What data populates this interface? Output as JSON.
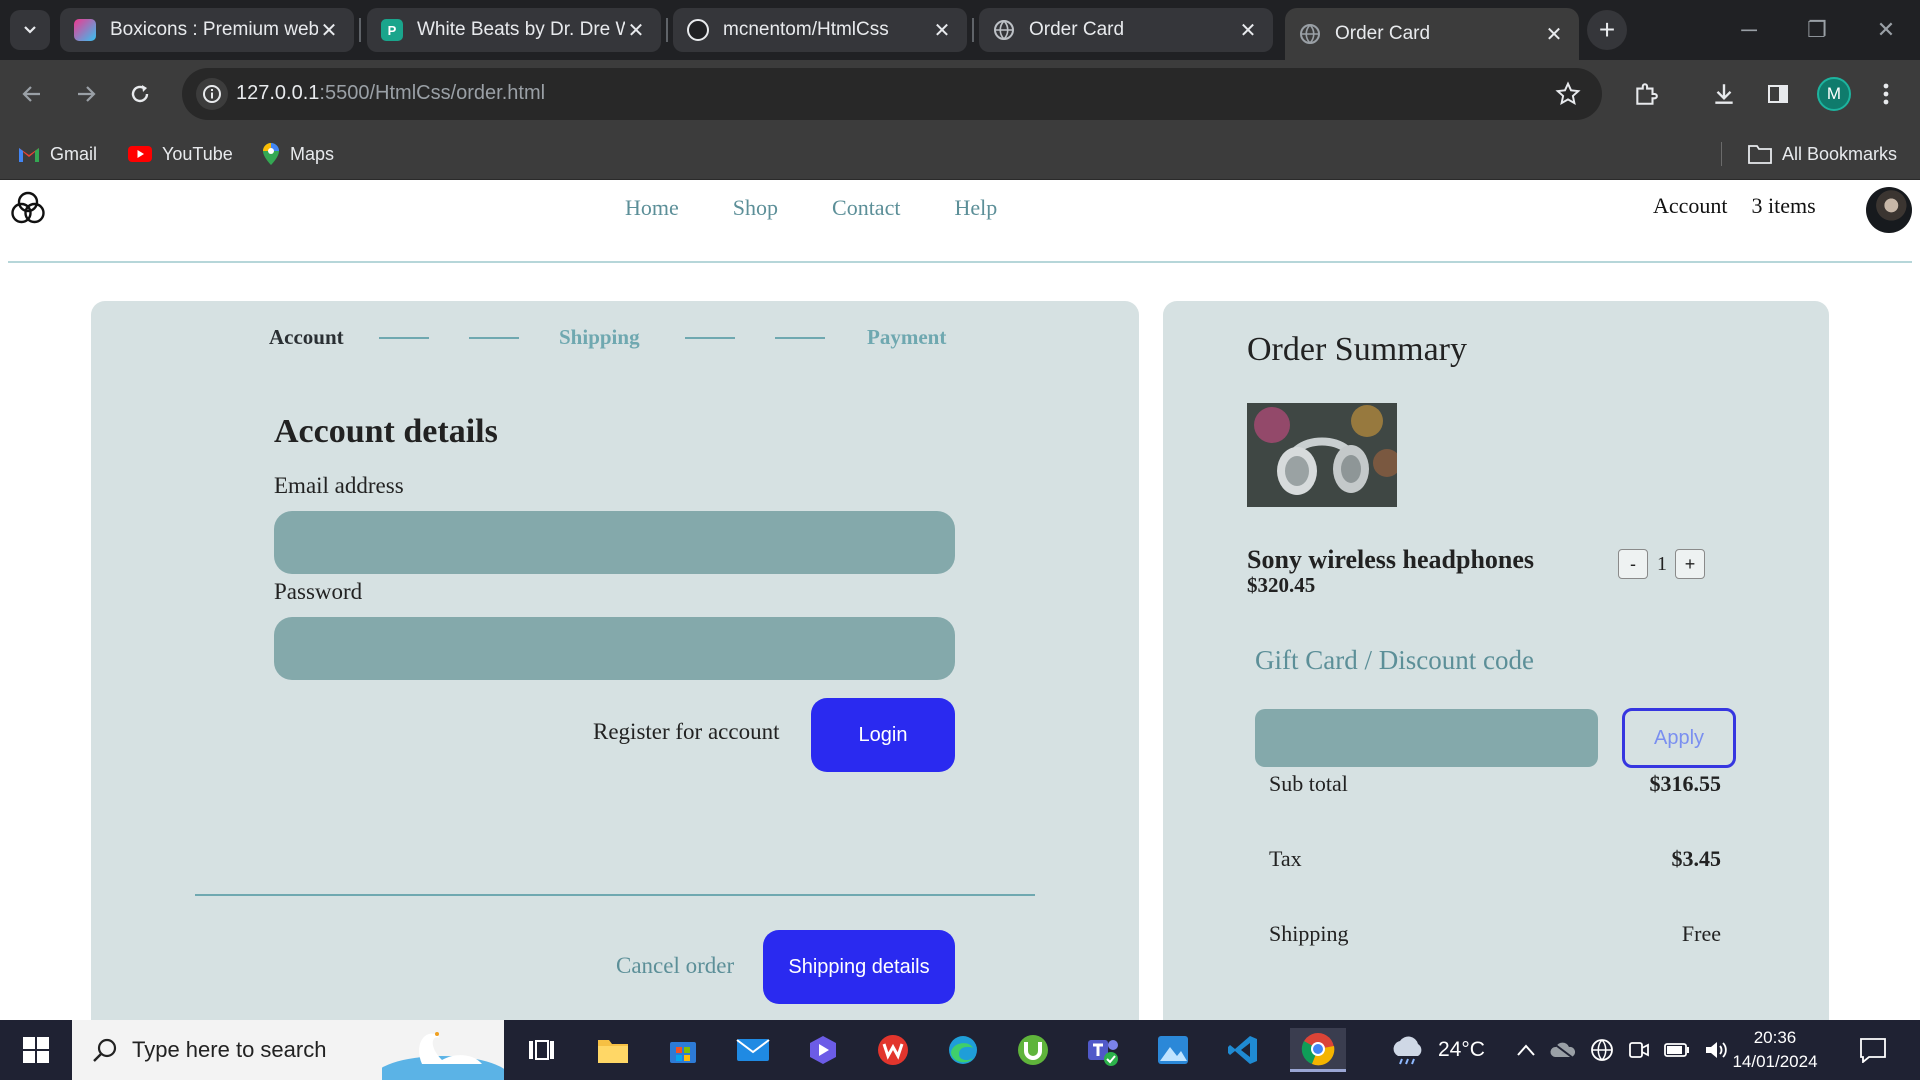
{
  "browser": {
    "tabs": [
      {
        "title": "Boxicons : Premium web",
        "active": false
      },
      {
        "title": "White Beats by Dr. Dre W",
        "active": false
      },
      {
        "title": "mcnentom/HtmlCss",
        "active": false
      },
      {
        "title": "Order Card",
        "active": false
      },
      {
        "title": "Order Card",
        "active": true
      }
    ],
    "url_host": "127.0.0.1",
    "url_path": ":5500/HtmlCss/order.html",
    "profile_initial": "M",
    "bookmarks": [
      {
        "label": "Gmail"
      },
      {
        "label": "YouTube"
      },
      {
        "label": "Maps"
      }
    ],
    "all_bookmarks": "All Bookmarks"
  },
  "site": {
    "nav": [
      "Home",
      "Shop",
      "Contact",
      "Help"
    ],
    "account_link": "Account",
    "cart_count": "3 items"
  },
  "checkout": {
    "steps": [
      {
        "label": "Account",
        "state": "current"
      },
      {
        "label": "Shipping",
        "state": "upcoming"
      },
      {
        "label": "Payment",
        "state": "upcoming"
      }
    ],
    "heading": "Account details",
    "email_label": "Email address",
    "email_value": "",
    "password_label": "Password",
    "password_value": "",
    "register_link": "Register for account",
    "login_button": "Login",
    "cancel_link": "Cancel order",
    "next_button": "Shipping details"
  },
  "summary": {
    "title": "Order Summary",
    "product": {
      "name": "Sony wireless headphones",
      "price": "$320.45",
      "quantity": "1",
      "minus": "-",
      "plus": "+"
    },
    "gift_title": "Gift Card / Discount code",
    "gift_value": "",
    "apply_button": "Apply",
    "rows": [
      {
        "label": "Sub total",
        "value": "$316.55"
      },
      {
        "label": "Tax",
        "value": "$3.45"
      },
      {
        "label": "Shipping",
        "value": "Free"
      }
    ]
  },
  "taskbar": {
    "search_placeholder": "Type here to search",
    "weather": "24°C",
    "time": "20:36",
    "date": "14/01/2024"
  },
  "colors": {
    "accent_blue": "#2a2af0",
    "teal_text": "#5c8f98",
    "card_bg": "#d6e1e2",
    "input_bg": "#84a9ab"
  }
}
